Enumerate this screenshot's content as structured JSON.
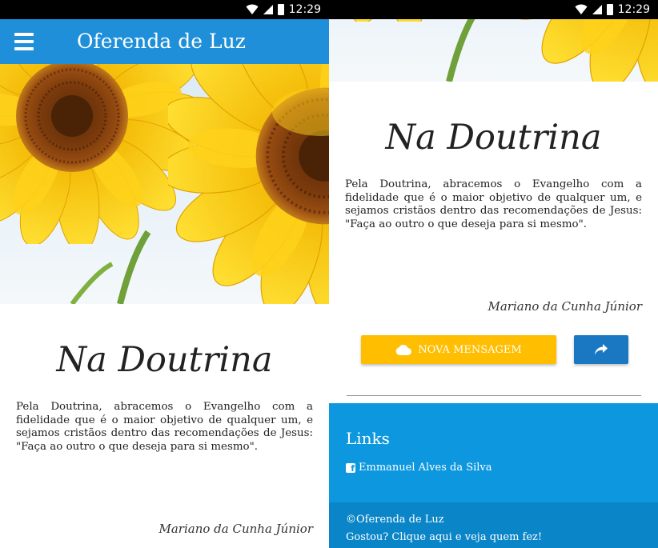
{
  "status_bar": {
    "time": "12:29"
  },
  "app_bar": {
    "title": "Oferenda de Luz"
  },
  "article": {
    "title": "Na Doutrina",
    "body": "Pela Doutrina, abracemos o Evangelho com a fidelidade que é o maior objetivo de qualquer um, e sejamos cristãos dentro das recomendações de Jesus: \"Faça ao outro o que deseja para si mesmo\".",
    "author": "Mariano da Cunha Júnior"
  },
  "actions": {
    "new_message_label": "NOVA MENSAGEM"
  },
  "links": {
    "title": "Links",
    "items": [
      {
        "label": "Emmanuel Alves da Silva"
      }
    ]
  },
  "footer": {
    "copyright": "©Oferenda de Luz",
    "credits": "Gostou? Clique aqui e veja quem fez!"
  },
  "colors": {
    "app_bar": "#1e8fd8",
    "links_section": "#0c97de",
    "footer": "#0a86c8",
    "button_primary": "#ffbe00",
    "button_share": "#1a78c2"
  },
  "icons": [
    "wifi-icon",
    "signal-icon",
    "battery-icon",
    "menu-icon",
    "cloud-icon",
    "share-icon",
    "facebook-icon"
  ]
}
